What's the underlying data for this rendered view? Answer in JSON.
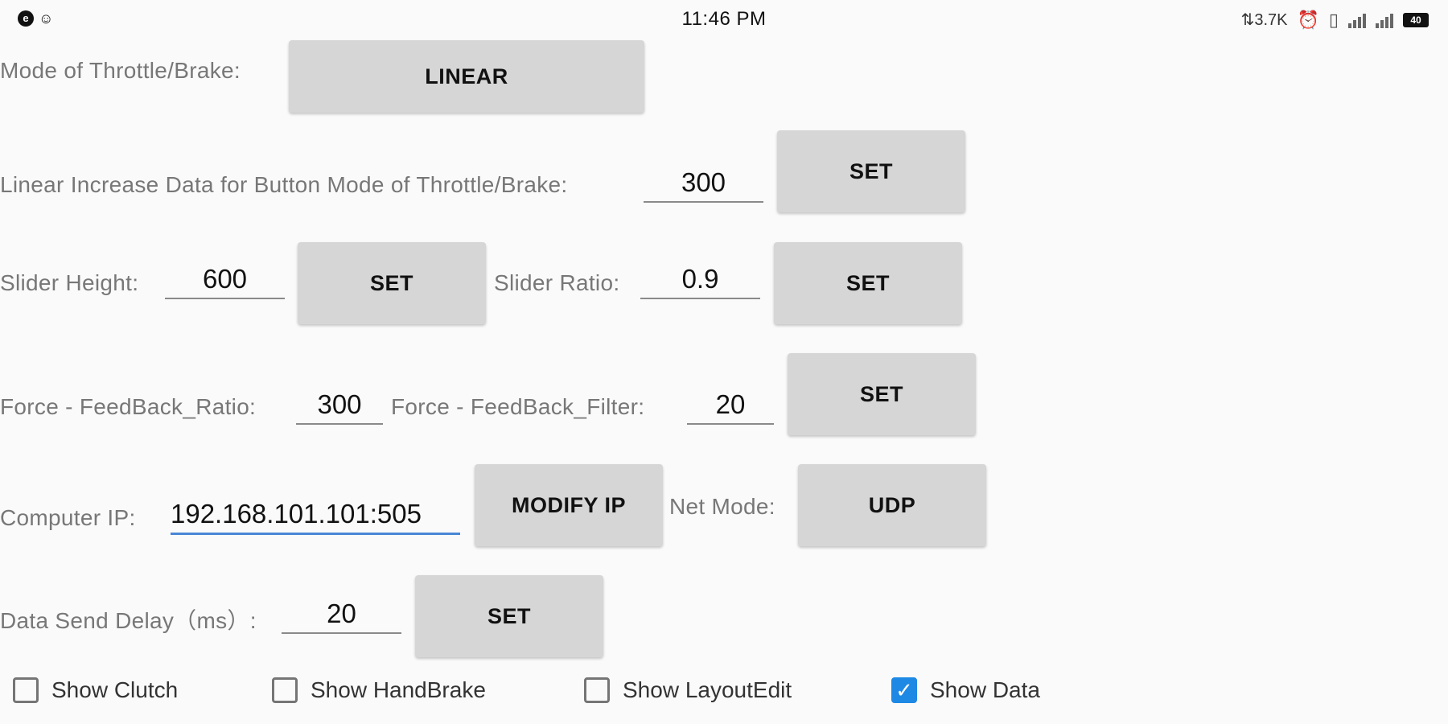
{
  "statusbar": {
    "time": "11:46 PM",
    "net_speed": "3.7K",
    "battery": "40"
  },
  "throttle_mode": {
    "label": "Mode of Throttle/Brake:",
    "button": "LINEAR"
  },
  "linear_increase": {
    "label": "Linear Increase Data for Button Mode of Throttle/Brake:",
    "value": "300",
    "button": "SET"
  },
  "slider": {
    "height_label": "Slider Height:",
    "height_value": "600",
    "height_button": "SET",
    "ratio_label": "Slider Ratio:",
    "ratio_value": "0.9",
    "ratio_button": "SET"
  },
  "force_feedback": {
    "ratio_label": "Force - FeedBack_Ratio:",
    "ratio_value": "300",
    "filter_label": "Force - FeedBack_Filter:",
    "filter_value": "20",
    "button": "SET"
  },
  "network": {
    "ip_label": "Computer IP:",
    "ip_value": "192.168.101.101:505",
    "modify_button": "MODIFY IP",
    "mode_label": "Net Mode:",
    "mode_button": "UDP"
  },
  "send_delay": {
    "label": "Data Send Delay（ms）:",
    "value": "20",
    "button": "SET"
  },
  "checkboxes": {
    "clutch": "Show Clutch",
    "handbrake": "Show HandBrake",
    "layout_edit": "Show LayoutEdit",
    "data": "Show Data"
  }
}
